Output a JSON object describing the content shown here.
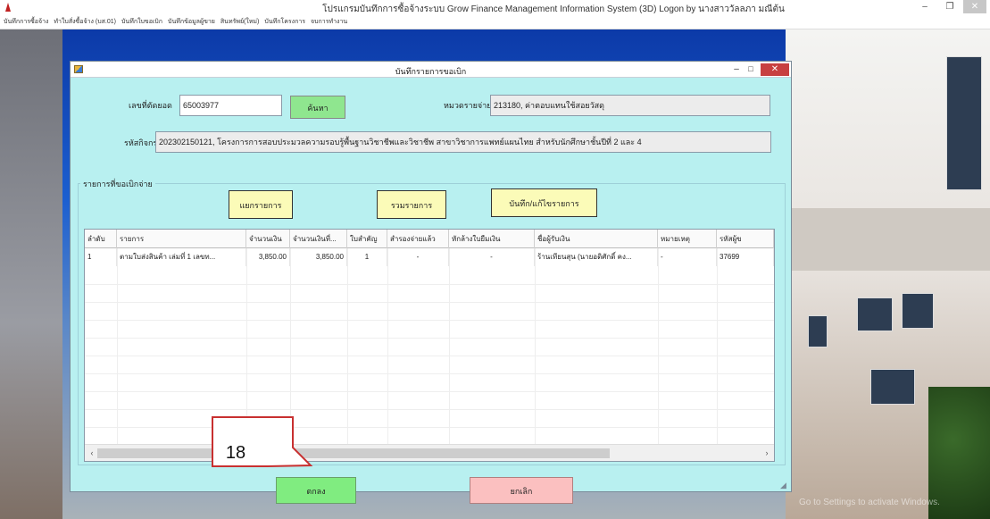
{
  "app": {
    "title": "โปรแกรมบันทึกการซื้อจ้างระบบ  Grow Finance Management Information System (3D)  Logon by นางสาววัลลภา  มณีต้น",
    "controls": {
      "minimize": "–",
      "restore": "❐",
      "close": "✕"
    },
    "menu": [
      "บันทึกการซื้อจ้าง",
      "ทำใบสั่งซื้อจ้าง (บส.01)",
      "บันทึกใบขอเบิก",
      "บันทึกข้อมูลผู้ขาย",
      "สินทรัพย์(ใหม่)",
      "บันทึกโครงการ",
      "จบการทำงาน"
    ]
  },
  "dialog": {
    "title": "บันทึกรายการขอเบิก",
    "controls": {
      "minimize": "–",
      "maximize": "□",
      "close": "✕"
    },
    "doc_no_label": "เลขที่ตัดยอด",
    "doc_no_value": "65003977",
    "search_button": "ค้นหา",
    "category_label": "หมวดรายจ่าย",
    "category_value": "213180, ค่าตอบแทนใช้สอยวัสดุ",
    "activity_label": "รหัสกิจกรรม",
    "activity_value": "202302150121, โครงการการสอบประมวลความรอบรู้พื้นฐานวิชาชีพและวิชาชีพ สาขาวิชาการแพทย์แผนไทย สำหรับนักศึกษาชั้นปีที่ 2 และ 4",
    "group_title": "รายการที่ขอเบิกจ่าย",
    "split_button": "แยกรายการ",
    "merge_button": "รวมรายการ",
    "save_edit_button": "บันทึก/แก้ไขรายการ",
    "grid": {
      "columns": [
        "ลำดับ",
        "รายการ",
        "จำนวนเงิน",
        "จำนวนเงินที่...",
        "ใบสำคัญ",
        "สำรองจ่ายแล้ว",
        "หักล้างใบยืมเงิน",
        "ชื่อผู้รับเงิน",
        "หมายเหตุ",
        "รหัสผู้ข"
      ],
      "rows": [
        [
          "1",
          "ตามใบส่งสินค้า เล่มที่ 1 เลขท...",
          "3,850.00",
          "3,850.00",
          "1",
          "-",
          "-",
          "ร้านเทียนสุน (นายอดิศักดิ์ คง...",
          "-",
          "37699"
        ]
      ],
      "scroll_left": "‹",
      "scroll_right": "›"
    },
    "ok_button": "ตกลง",
    "cancel_button": "ยกเลิก"
  },
  "annotation": {
    "label": "18"
  },
  "watermark": "Go to Settings to activate Windows."
}
